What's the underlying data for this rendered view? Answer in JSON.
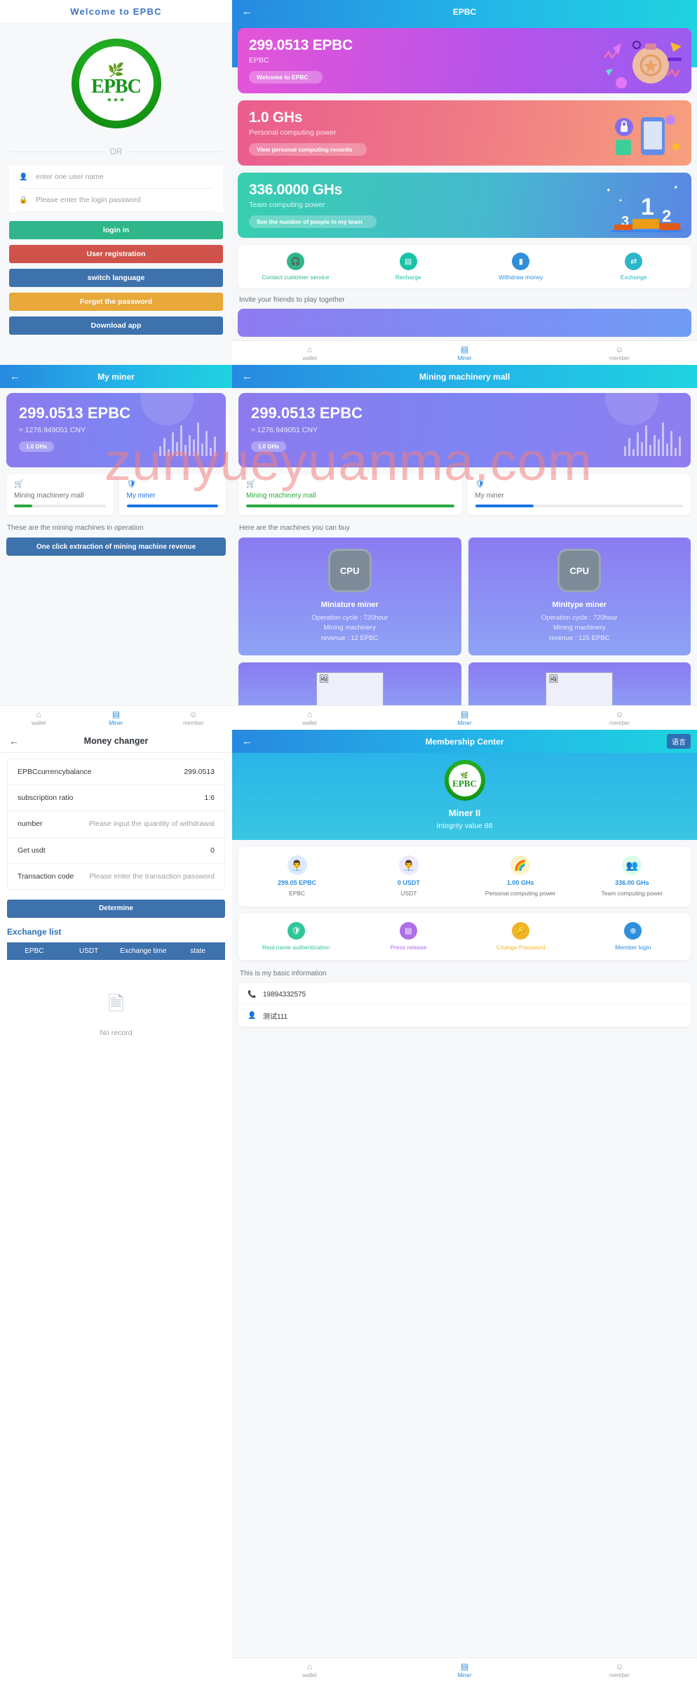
{
  "login": {
    "header_title": "Welcome to EPBC",
    "logo": {
      "text": "EPBC",
      "leaf_icon": "🌿",
      "stars": "★★★"
    },
    "divider_label": "OR",
    "username": {
      "placeholder": "enter one user name",
      "value": "",
      "icon": "user-icon"
    },
    "password": {
      "placeholder": "Please enter the login password",
      "value": "",
      "icon": "lock-icon"
    },
    "buttons": [
      {
        "label": "login in",
        "color": "#2fb68a",
        "name": "login-button"
      },
      {
        "label": "User registration",
        "color": "#cf534b",
        "name": "register-button"
      },
      {
        "label": "switch language",
        "color": "#3d72ad",
        "name": "switch-language-button"
      },
      {
        "label": "Forget the password",
        "color": "#e8a83a",
        "name": "forgot-password-button"
      },
      {
        "label": "Download app",
        "color": "#3d72ad",
        "name": "download-app-button"
      }
    ]
  },
  "dashboard": {
    "header_title": "EPBC",
    "back_icon": "arrow-left-icon",
    "cards": [
      {
        "value": "299.0513 EPBC",
        "label": "EPBC",
        "pill": "Welcome to EPBC",
        "arrow": "↑"
      },
      {
        "value": "1.0 GHs",
        "label": "Personal computing power",
        "pill": "View personal computing records",
        "arrow": "↑"
      },
      {
        "value": "336.0000 GHs",
        "label": "Team computing power",
        "pill": "See the number of people in my team",
        "arrow": "↑"
      }
    ],
    "quick_actions": [
      {
        "label": "Contact customer service",
        "icon": "headset-icon",
        "color": "#2fb68a"
      },
      {
        "label": "Recharge",
        "icon": "recharge-icon",
        "color": "#17c3a4"
      },
      {
        "label": "Withdraw money",
        "icon": "withdraw-icon",
        "color": "#2f8fdd"
      },
      {
        "label": "Exchange",
        "icon": "exchange-icon",
        "color": "#2bb7c9"
      }
    ],
    "invite_text": "Invite your friends to play together",
    "tabbar": [
      {
        "label": "wallet",
        "icon": "home-icon",
        "active": false
      },
      {
        "label": "Miner",
        "icon": "miner-icon",
        "active": true
      },
      {
        "label": "member",
        "icon": "user-circle-icon",
        "active": false
      }
    ]
  },
  "my_miner": {
    "header_title": "My miner",
    "back_icon": "arrow-left-icon",
    "balance": "299.0513 EPBC",
    "cny": "≈ 1276.949051 CNY",
    "ghs_badge": "1.0 GHs",
    "tabs": [
      {
        "label": "Mining machinery mall",
        "icon": "cart-icon",
        "icon_color": "#2ba83d",
        "bar_color": "#2ba83d",
        "bar_pct": 20,
        "active": false
      },
      {
        "label": "My miner",
        "icon": "shield-icon",
        "icon_color": "#1a73e8",
        "bar_color": "#1a73e8",
        "bar_pct": 100,
        "active": true
      }
    ],
    "note": "These are the mining machines in operation",
    "extract_button": "One click extraction of mining machine revenue",
    "tabbar": [
      {
        "label": "wallet",
        "icon": "home-icon",
        "active": false
      },
      {
        "label": "Miner",
        "icon": "miner-icon",
        "active": true
      },
      {
        "label": "member",
        "icon": "user-circle-icon",
        "active": false
      }
    ]
  },
  "mall": {
    "header_title": "Mining machinery mall",
    "back_icon": "arrow-left-icon",
    "balance": "299.0513 EPBC",
    "cny": "≈ 1276.949051 CNY",
    "ghs_badge": "1.0 GHs",
    "tabs": [
      {
        "label": "Mining machinery mall",
        "icon": "cart-icon",
        "icon_color": "#2ba83d",
        "bar_color": "#2ba83d",
        "bar_pct": 100,
        "active": true
      },
      {
        "label": "My miner",
        "icon": "shield-icon",
        "icon_color": "#1a73e8",
        "bar_color": "#1a73e8",
        "bar_pct": 28,
        "active": false
      }
    ],
    "note": "Here are the machines you can buy",
    "products": [
      {
        "name": "Miniature miner",
        "icon": "cpu-icon",
        "icon_label": "CPU",
        "line1": "Operation cycle : 720hour",
        "line2": "Mining machinery",
        "line3": "revenue : 12 EPBC"
      },
      {
        "name": "Minitype miner",
        "icon": "cpu-icon",
        "icon_label": "CPU",
        "line1": "Operation cycle : 720hour",
        "line2": "Mining machinery",
        "line3": "revenue : 125 EPBC"
      }
    ],
    "tabbar": [
      {
        "label": "wallet",
        "icon": "home-icon",
        "active": false
      },
      {
        "label": "Miner",
        "icon": "miner-icon",
        "active": true
      },
      {
        "label": "member",
        "icon": "user-circle-icon",
        "active": false
      }
    ]
  },
  "money_changer": {
    "header_title": "Money changer",
    "back_icon": "arrow-left-icon",
    "rows": [
      {
        "key": "EPBCcurrencybalance",
        "value": "299.0513",
        "placeholder": false
      },
      {
        "key": "subscription ratio",
        "value": "1:6",
        "placeholder": false
      },
      {
        "key": "number",
        "value": "Please input the quantity of withdrawal",
        "placeholder": true
      },
      {
        "key": "Get usdt",
        "value": "0",
        "placeholder": false
      },
      {
        "key": "Transaction code",
        "value": "Please enter the transaction password",
        "placeholder": true
      }
    ],
    "determine_button": "Determine",
    "exchange_list_title": "Exchange list",
    "table_headers": [
      "EPBC",
      "USDT",
      "Exchange time",
      "state"
    ],
    "empty_text": "No record",
    "empty_icon": "document-icon"
  },
  "membership": {
    "header_title": "Membership Center",
    "back_icon": "arrow-left-icon",
    "language_button": "语言",
    "logo": {
      "text": "EPBC",
      "leaf_icon": "🌿"
    },
    "member_name": "Miner II",
    "integrity": "Integrity value 88",
    "stats": [
      {
        "value": "299.05 EPBC",
        "desc": "EPBC",
        "icon": "avatar-blue-icon"
      },
      {
        "value": "0 USDT",
        "desc": "USDT",
        "icon": "avatar-purple-icon"
      },
      {
        "value": "1.00 GHs",
        "desc": "Personal computing power",
        "icon": "rainbow-icon"
      },
      {
        "value": "336.00 GHs",
        "desc": "Team computing power",
        "icon": "team-icon"
      }
    ],
    "actions": [
      {
        "label": "Real name authentication",
        "icon": "shield-check-icon",
        "color": "#2fc79a",
        "text_color": "#2fc79a"
      },
      {
        "label": "Press release",
        "icon": "news-icon",
        "color": "#b06fe8",
        "text_color": "#b06fe8"
      },
      {
        "label": "Change Password",
        "icon": "key-icon",
        "color": "#f0b429",
        "text_color": "#f0b429"
      },
      {
        "label": "Member login",
        "icon": "login-icon",
        "color": "#2f8fdd",
        "text_color": "#2f8fdd"
      }
    ],
    "basic_title": "This is my basic information",
    "info_rows": [
      {
        "icon": "phone-icon",
        "value": "19894332575"
      },
      {
        "icon": "user-icon",
        "value": "测试111"
      }
    ],
    "tabbar": [
      {
        "label": "wallet",
        "icon": "home-icon",
        "active": false
      },
      {
        "label": "Miner",
        "icon": "miner-icon",
        "active": true
      },
      {
        "label": "member",
        "icon": "user-circle-icon",
        "active": false
      }
    ]
  },
  "watermark": {
    "text": "zunyueyuanma.com"
  }
}
